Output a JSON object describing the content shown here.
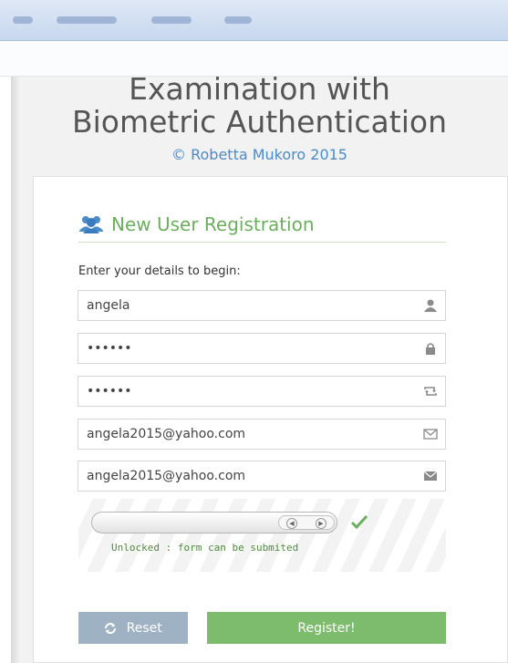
{
  "browser": {
    "background": "#dfe9f7"
  },
  "header": {
    "title_line1": "Examination with",
    "title_line2": "Biometric Authentication",
    "copyright": "© Robetta Mukoro 2015",
    "title_color": "#555555",
    "copyright_color": "#4a8bc9"
  },
  "registration": {
    "title": "New User Registration",
    "title_color": "#6bae5d",
    "icon": "users-icon",
    "instructions": "Enter your details to begin:",
    "fields": {
      "username": {
        "value": "angela",
        "icon": "user-icon"
      },
      "password": {
        "value": "••••••",
        "icon": "lock-icon"
      },
      "confirm_password": {
        "value": "••••••",
        "icon": "retweet-icon"
      },
      "email": {
        "value": "angela2015@yahoo.com",
        "icon": "envelope-outline-icon"
      },
      "confirm_email": {
        "value": "angela2015@yahoo.com",
        "icon": "envelope-icon"
      }
    },
    "slider": {
      "status": "Unlocked : form can be submited",
      "unlocked": true,
      "status_icon": "check-icon",
      "status_color": "#4f8a3d"
    },
    "buttons": {
      "reset": "Reset",
      "register": "Register!",
      "reset_color": "#9eb2c3",
      "register_color": "#7cbc6c"
    }
  }
}
